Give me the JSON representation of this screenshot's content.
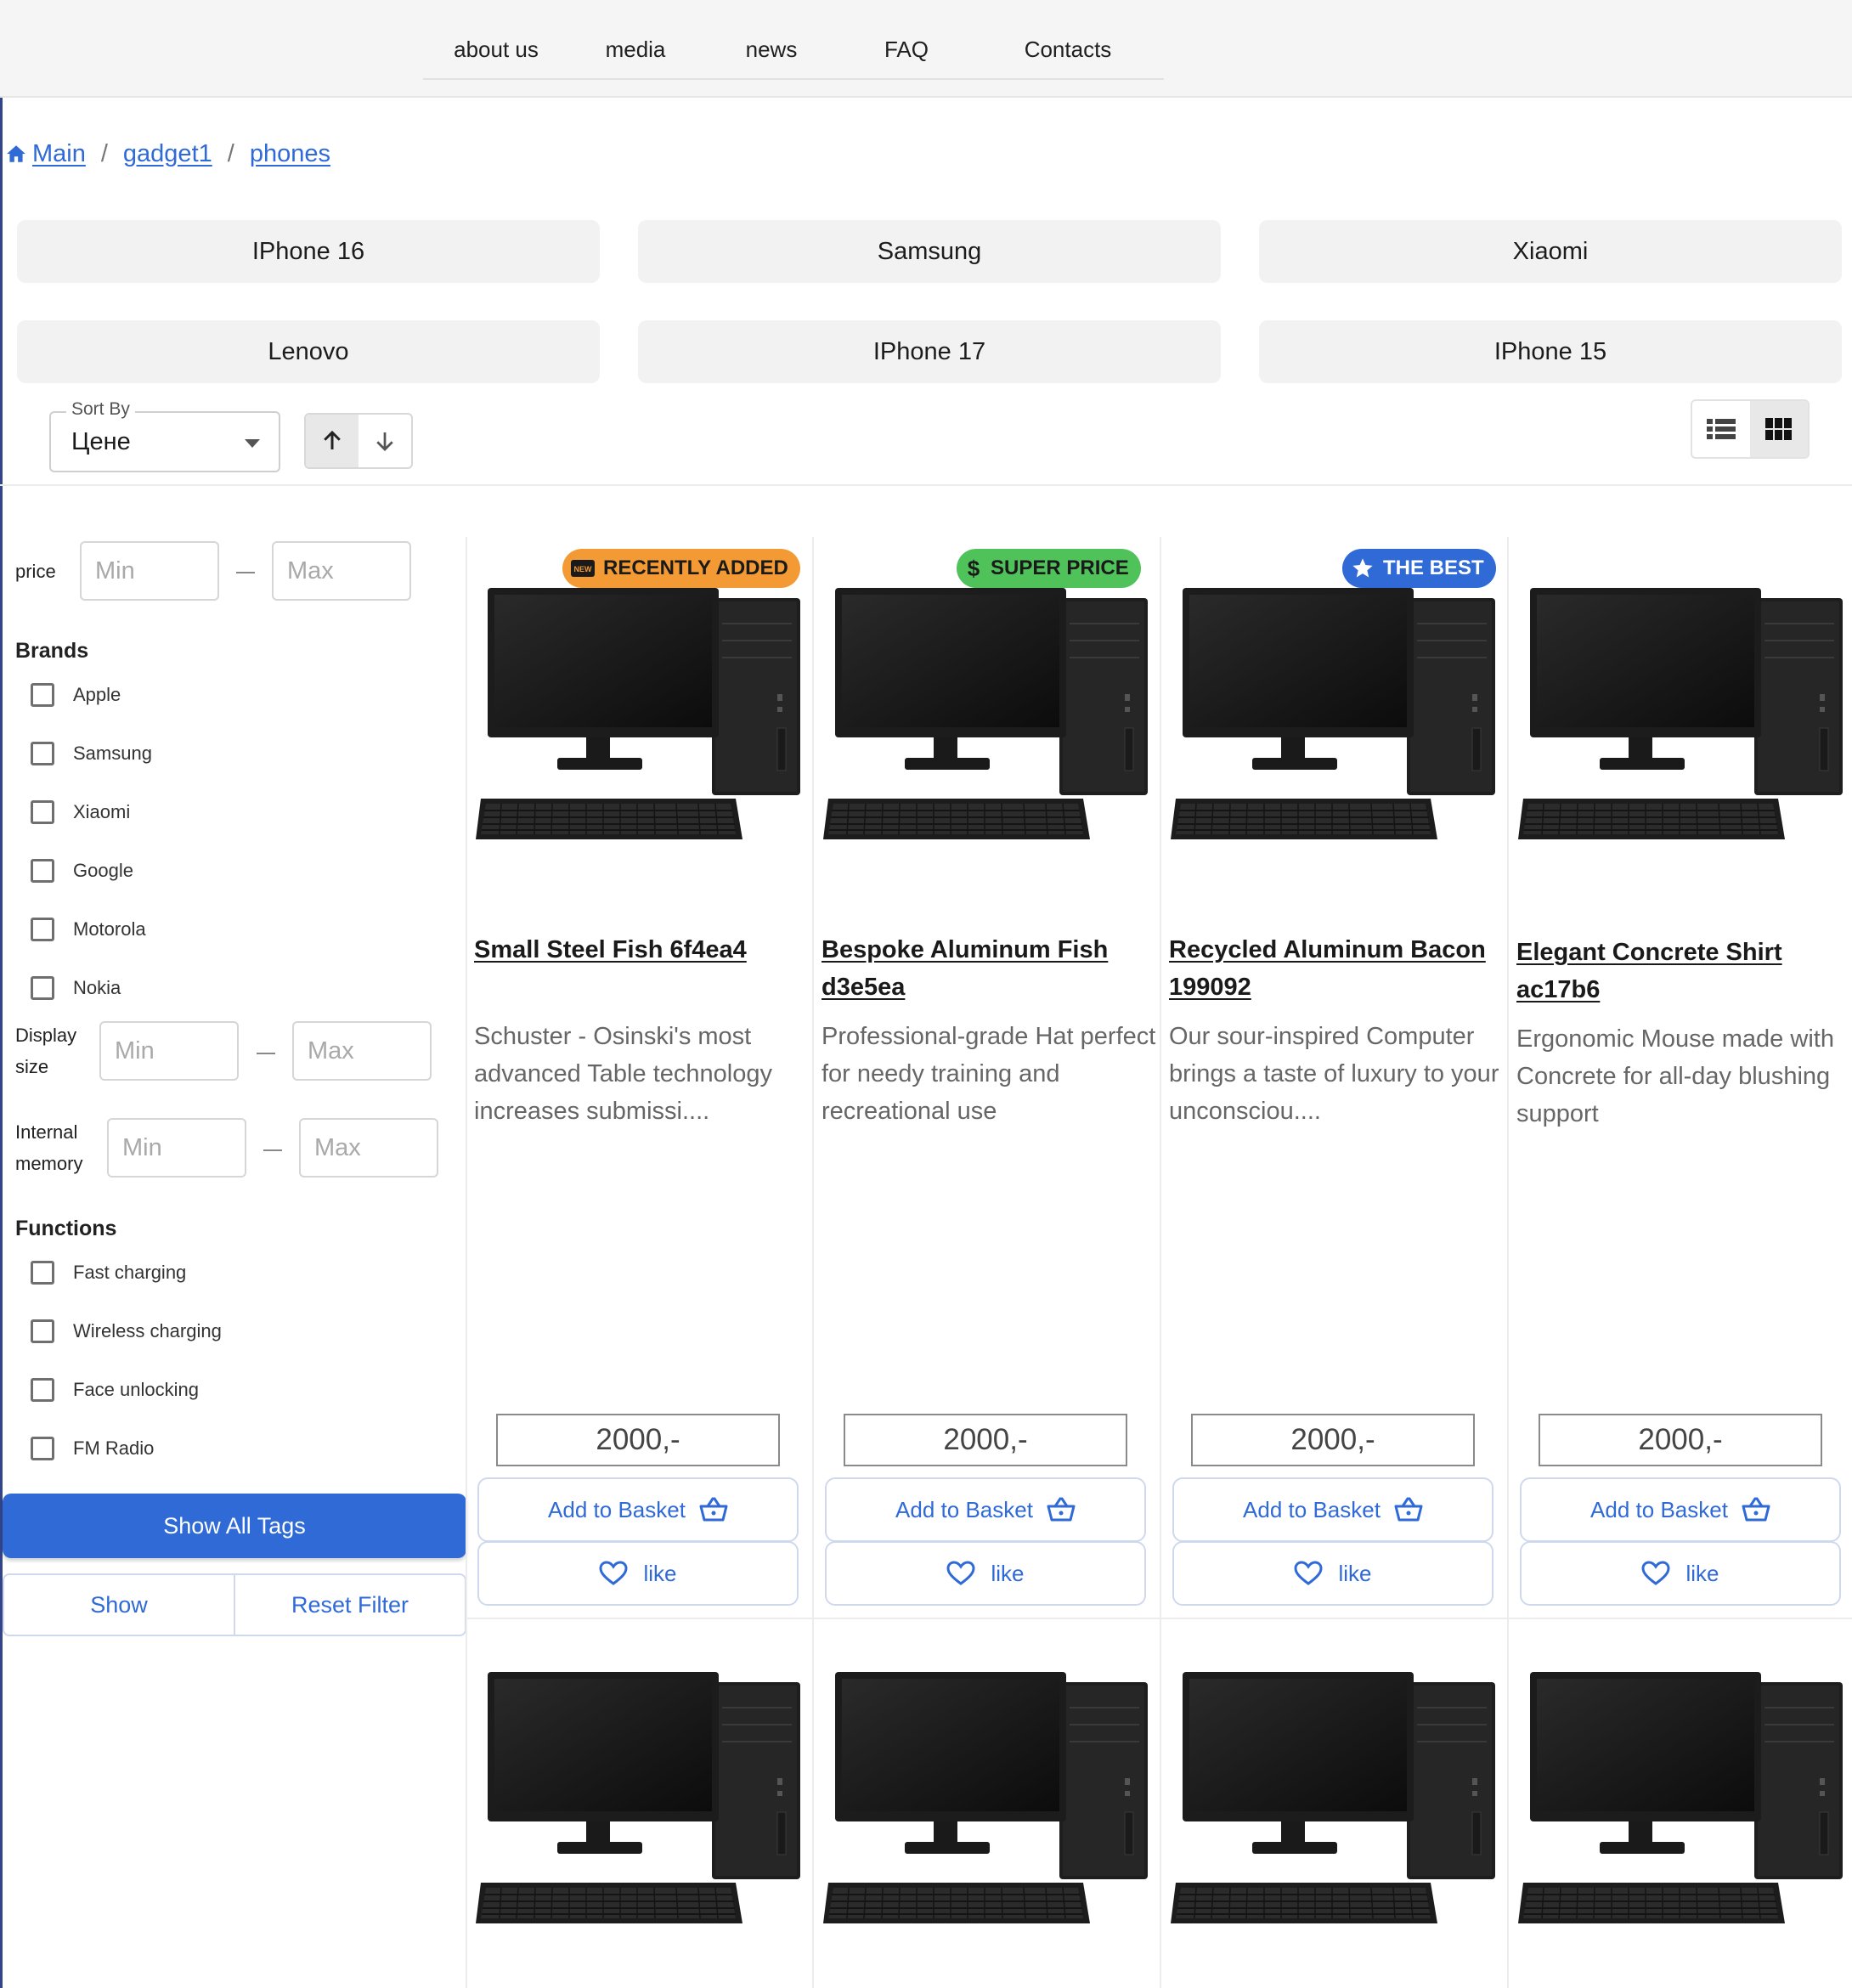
{
  "nav": [
    "about us",
    "media",
    "news",
    "FAQ",
    "Contacts"
  ],
  "breadcrumb": [
    "Main",
    "gadget1",
    "phones"
  ],
  "tags": [
    "IPhone 16",
    "Samsung",
    "Xiaomi",
    "Lenovo",
    "IPhone 17",
    "IPhone 15"
  ],
  "sort": {
    "legend": "Sort By",
    "value": "Цене",
    "direction": "up"
  },
  "view": {
    "selected": "grid"
  },
  "filters": {
    "price": {
      "label": "price",
      "min": "Min",
      "max": "Max"
    },
    "brands_title": "Brands",
    "brands": [
      "Apple",
      "Samsung",
      "Xiaomi",
      "Google",
      "Motorola",
      "Nokia"
    ],
    "display": {
      "label_line1": "Display",
      "label_line2": "size",
      "min": "Min",
      "max": "Max"
    },
    "memory": {
      "label_line1": "Internal",
      "label_line2": "memory",
      "min": "Min",
      "max": "Max"
    },
    "functions_title": "Functions",
    "functions": [
      "Fast charging",
      "Wireless charging",
      "Face unlocking",
      "FM Radio"
    ],
    "show_all_tags": "Show All Tags",
    "show": "Show",
    "reset": "Reset Filter"
  },
  "product_buttons": {
    "basket": "Add to Basket",
    "like": "like"
  },
  "products": [
    {
      "badge": "RECENTLY ADDED",
      "badge_color": "#f39a35",
      "badge_icon": "new-icon",
      "title": "Small Steel Fish 6f4ea4",
      "desc": "Schuster - Osinski's most advanced Table technology increases submissi....",
      "price": "2000,-"
    },
    {
      "badge": "SUPER PRICE",
      "badge_color": "#4fc25a",
      "badge_icon": "dollar-icon",
      "title": "Bespoke Aluminum Fish d3e5ea",
      "desc": "Professional-grade Hat perfect for needy training and recreational use",
      "price": "2000,-"
    },
    {
      "badge": "THE BEST",
      "badge_color": "#2f6ad6",
      "badge_icon": "star-icon",
      "title": "Recycled Aluminum Bacon 199092",
      "desc": "Our sour-inspired Computer brings a taste of luxury to your unconsciou....",
      "price": "2000,-"
    },
    {
      "badge": "",
      "badge_color": "",
      "badge_icon": "",
      "title": "Elegant Concrete Shirt ac17b6",
      "desc": "Ergonomic Mouse made with Concrete for all-day blushing support",
      "price": "2000,-"
    }
  ],
  "colors": {
    "accent": "#2f6ad6",
    "nav_bg": "#f5f5f5",
    "tag_bg": "#f2f2f2"
  }
}
